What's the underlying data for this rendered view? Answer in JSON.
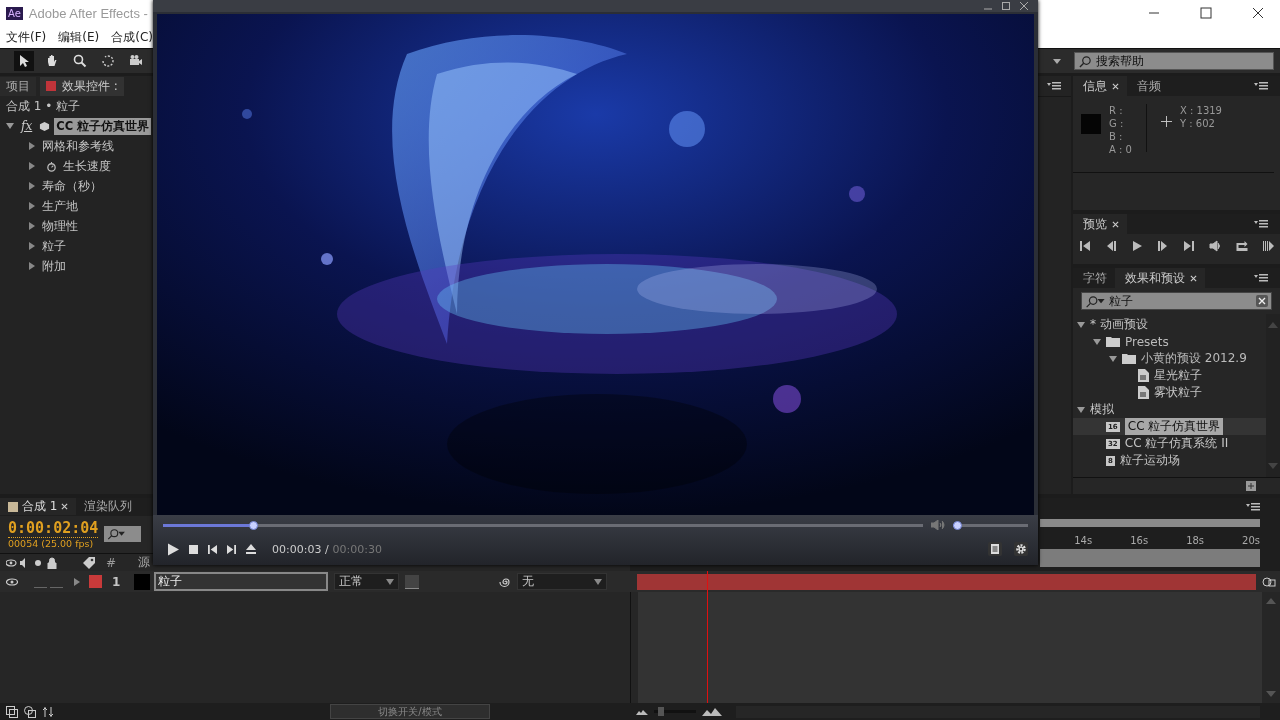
{
  "app": {
    "logo": "Ae",
    "title": "Adobe After Effects -",
    "menu": [
      "文件(F)",
      "编辑(E)",
      "合成(C)"
    ]
  },
  "help_search": {
    "placeholder": "搜索帮助"
  },
  "left_panel": {
    "tabs": [
      {
        "label": "项目",
        "selected": false
      },
      {
        "label": "效果控件 :",
        "selected": true
      }
    ],
    "breadcrumb": "合成 1 • 粒子",
    "effect": {
      "fx": "fx",
      "name": "CC 粒子仿真世界",
      "expanded": true
    },
    "properties": [
      {
        "label": "网格和参考线",
        "kind": "group",
        "expanded": false
      },
      {
        "label": "生长速度",
        "kind": "stopwatch",
        "expanded": false
      },
      {
        "label": "寿命（秒）",
        "kind": "group",
        "expanded": false
      },
      {
        "label": "生产地",
        "kind": "group",
        "expanded": false
      },
      {
        "label": "物理性",
        "kind": "group",
        "expanded": false
      },
      {
        "label": "粒子",
        "kind": "group",
        "expanded": false
      },
      {
        "label": "附加",
        "kind": "group",
        "expanded": false
      }
    ]
  },
  "info_panel": {
    "tabs": [
      {
        "label": "信息",
        "selected": true
      },
      {
        "label": "音频",
        "selected": false
      }
    ],
    "channels": [
      "R :",
      "G :",
      "B :",
      "A : 0"
    ],
    "x": "X : 1319",
    "y": "Y : 602"
  },
  "preview_panel": {
    "title": "预览"
  },
  "effects_panel": {
    "tabs": [
      {
        "label": "字符",
        "selected": false
      },
      {
        "label": "效果和预设",
        "selected": true
      }
    ],
    "search": {
      "value": "粒子"
    },
    "tree": [
      {
        "label": "* 动画预设",
        "kind": "category",
        "expanded": true,
        "selected": false,
        "children": [
          {
            "label": "Presets",
            "kind": "folder",
            "expanded": true,
            "selected": false,
            "children": [
              {
                "label": "小黄的预设 2012.9",
                "kind": "folder",
                "expanded": true,
                "selected": false,
                "children": [
                  {
                    "label": "星光粒子",
                    "kind": "preset",
                    "selected": false
                  },
                  {
                    "label": "雾状粒子",
                    "kind": "preset",
                    "selected": false
                  }
                ]
              }
            ]
          }
        ]
      },
      {
        "label": "模拟",
        "kind": "category",
        "expanded": true,
        "selected": false,
        "children": [
          {
            "label": "CC 粒子仿真世界",
            "kind": "effect",
            "badge": "16",
            "selected": true
          },
          {
            "label": "CC 粒子仿真系统 II",
            "kind": "effect",
            "badge": "32",
            "selected": false
          },
          {
            "label": "粒子运动场",
            "kind": "effect",
            "badge": "8",
            "selected": false
          }
        ]
      }
    ]
  },
  "timeline": {
    "tabs": [
      {
        "label": "合成 1",
        "selected": true
      },
      {
        "label": "渲染队列",
        "selected": false
      }
    ],
    "timecode": "0:00:02:04",
    "frame": "00054 (25.00 fps)",
    "column_headers": [
      "#",
      "源"
    ],
    "layers": [
      {
        "number": "1",
        "name": "粒子",
        "mode": "正常",
        "parent": "无",
        "visible": true,
        "color": "#c83a3a"
      }
    ],
    "ruler": [
      "14s",
      "16s",
      "18s",
      "20s"
    ],
    "playhead": {
      "level": 0.11
    },
    "zoom": {
      "level": 0.1
    },
    "footer_button": "切换开关/模式"
  },
  "player": {
    "progress": {
      "level": 0.118
    },
    "volume": {
      "level": 0.05
    },
    "time": "00:00:03 /",
    "duration": "00:00:30"
  }
}
